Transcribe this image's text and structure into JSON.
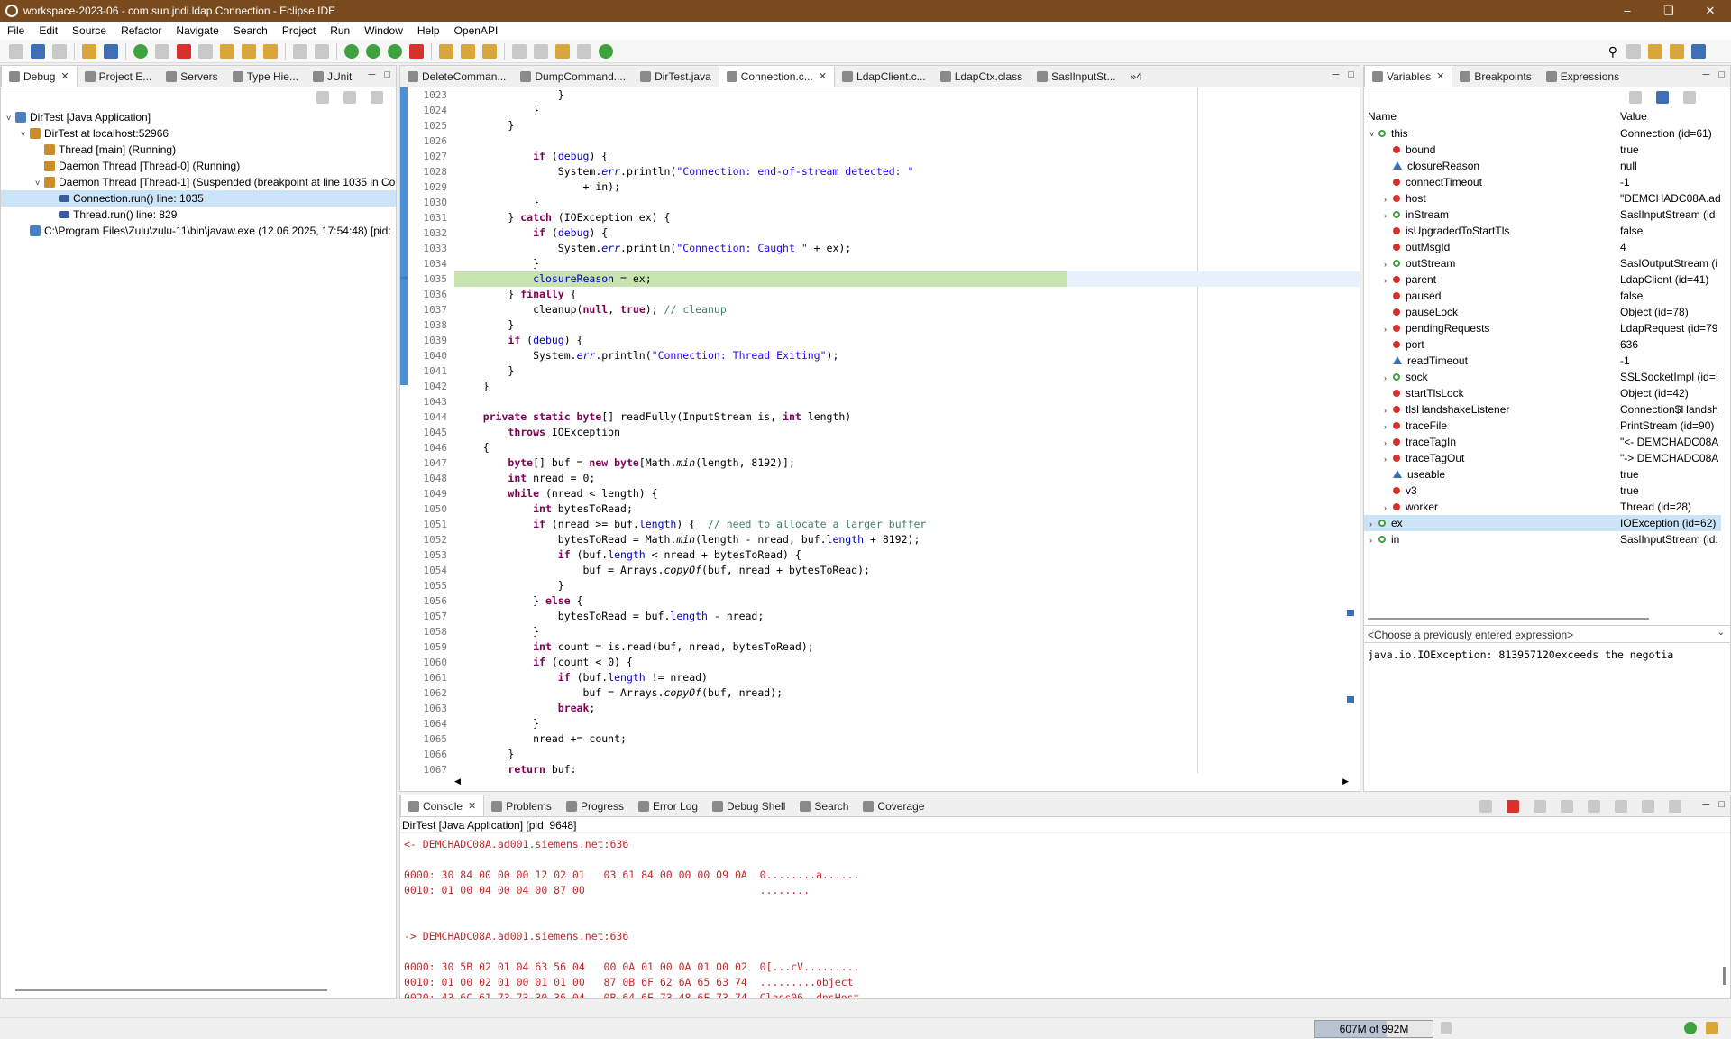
{
  "window": {
    "title": "workspace-2023-06 - com.sun.jndi.ldap.Connection - Eclipse IDE"
  },
  "menu": [
    "File",
    "Edit",
    "Source",
    "Refactor",
    "Navigate",
    "Search",
    "Project",
    "Run",
    "Window",
    "Help",
    "OpenAPI"
  ],
  "debug_panel": {
    "tabs": [
      "Debug",
      "Project E...",
      "Servers",
      "Type Hie...",
      "JUnit"
    ],
    "tree": [
      {
        "label": "DirTest [Java Application]",
        "indent": 0,
        "icon": "app",
        "arrow": "v"
      },
      {
        "label": "DirTest at localhost:52966",
        "indent": 1,
        "icon": "vm",
        "arrow": "v"
      },
      {
        "label": "Thread [main] (Running)",
        "indent": 2,
        "icon": "thread",
        "arrow": ""
      },
      {
        "label": "Daemon Thread [Thread-0] (Running)",
        "indent": 2,
        "icon": "thread",
        "arrow": ""
      },
      {
        "label": "Daemon Thread [Thread-1] (Suspended (breakpoint at line 1035 in Co",
        "indent": 2,
        "icon": "thread",
        "arrow": "v"
      },
      {
        "label": "Connection.run() line: 1035",
        "indent": 3,
        "icon": "frame",
        "arrow": "",
        "selected": true
      },
      {
        "label": "Thread.run() line: 829",
        "indent": 3,
        "icon": "frame",
        "arrow": ""
      },
      {
        "label": "C:\\Program Files\\Zulu\\zulu-11\\bin\\javaw.exe (12.06.2025, 17:54:48) [pid:",
        "indent": 1,
        "icon": "exe",
        "arrow": ""
      }
    ]
  },
  "editor": {
    "tabs": [
      "DeleteComman...",
      "DumpCommand....",
      "DirTest.java",
      "Connection.c...",
      "LdapClient.c...",
      "LdapCtx.class",
      "SaslInputSt..."
    ],
    "overflow": "»4",
    "lines": [
      {
        "n": "1023",
        "html": "                }"
      },
      {
        "n": "1024",
        "html": "            }"
      },
      {
        "n": "1025",
        "html": "        }"
      },
      {
        "n": "1026",
        "html": ""
      },
      {
        "n": "1027",
        "html": "            <span class='kw'>if</span> (<span class='fld'>debug</span>) {"
      },
      {
        "n": "1028",
        "html": "                System.<span class='fld it'>err</span>.println(<span class='str'>\"Connection: end-of-stream detected: \"</span>"
      },
      {
        "n": "1029",
        "html": "                    + in);"
      },
      {
        "n": "1030",
        "html": "            }"
      },
      {
        "n": "1031",
        "html": "        } <span class='kw'>catch</span> (IOException ex) {"
      },
      {
        "n": "1032",
        "html": "            <span class='kw'>if</span> (<span class='fld'>debug</span>) {"
      },
      {
        "n": "1033",
        "html": "                System.<span class='fld it'>err</span>.println(<span class='str'>\"Connection: Caught \"</span> + ex);"
      },
      {
        "n": "1034",
        "html": "            }"
      },
      {
        "n": "1035",
        "html": "            <span class='fld'>closureReason</span> = ex;",
        "hl": true
      },
      {
        "n": "1036",
        "html": "        } <span class='kw'>finally</span> {"
      },
      {
        "n": "1037",
        "html": "            cleanup(<span class='kw'>null</span>, <span class='kw'>true</span>); <span class='cm'>// cleanup</span>"
      },
      {
        "n": "1038",
        "html": "        }"
      },
      {
        "n": "1039",
        "html": "        <span class='kw'>if</span> (<span class='fld'>debug</span>) {"
      },
      {
        "n": "1040",
        "html": "            System.<span class='fld it'>err</span>.println(<span class='str'>\"Connection: Thread Exiting\"</span>);"
      },
      {
        "n": "1041",
        "html": "        }"
      },
      {
        "n": "1042",
        "html": "    }"
      },
      {
        "n": "1043",
        "html": ""
      },
      {
        "n": "1044",
        "html": "    <span class='kw'>private static byte</span>[] readFully(InputStream is, <span class='kw'>int</span> length)"
      },
      {
        "n": "1045",
        "html": "        <span class='kw'>throws</span> IOException"
      },
      {
        "n": "1046",
        "html": "    {"
      },
      {
        "n": "1047",
        "html": "        <span class='kw'>byte</span>[] buf = <span class='kw'>new byte</span>[Math.<span class='it'>min</span>(length, 8192)];"
      },
      {
        "n": "1048",
        "html": "        <span class='kw'>int</span> nread = 0;"
      },
      {
        "n": "1049",
        "html": "        <span class='kw'>while</span> (nread &lt; length) {"
      },
      {
        "n": "1050",
        "html": "            <span class='kw'>int</span> bytesToRead;"
      },
      {
        "n": "1051",
        "html": "            <span class='kw'>if</span> (nread &gt;= buf.<span class='fld'>length</span>) {  <span class='cm'>// need to allocate a larger buffer</span>"
      },
      {
        "n": "1052",
        "html": "                bytesToRead = Math.<span class='it'>min</span>(length - nread, buf.<span class='fld'>length</span> + 8192);"
      },
      {
        "n": "1053",
        "html": "                <span class='kw'>if</span> (buf.<span class='fld'>length</span> &lt; nread + bytesToRead) {"
      },
      {
        "n": "1054",
        "html": "                    buf = Arrays.<span class='it'>copyOf</span>(buf, nread + bytesToRead);"
      },
      {
        "n": "1055",
        "html": "                }"
      },
      {
        "n": "1056",
        "html": "            } <span class='kw'>else</span> {"
      },
      {
        "n": "1057",
        "html": "                bytesToRead = buf.<span class='fld'>length</span> - nread;"
      },
      {
        "n": "1058",
        "html": "            }"
      },
      {
        "n": "1059",
        "html": "            <span class='kw'>int</span> count = is.read(buf, nread, bytesToRead);"
      },
      {
        "n": "1060",
        "html": "            <span class='kw'>if</span> (count &lt; 0) {"
      },
      {
        "n": "1061",
        "html": "                <span class='kw'>if</span> (buf.<span class='fld'>length</span> != nread)"
      },
      {
        "n": "1062",
        "html": "                    buf = Arrays.<span class='it'>copyOf</span>(buf, nread);"
      },
      {
        "n": "1063",
        "html": "                <span class='kw'>break</span>;"
      },
      {
        "n": "1064",
        "html": "            }"
      },
      {
        "n": "1065",
        "html": "            nread += count;"
      },
      {
        "n": "1066",
        "html": "        }"
      },
      {
        "n": "1067",
        "html": "        <span class='kw'>return</span> buf;"
      }
    ]
  },
  "variables_panel": {
    "tabs": [
      "Variables",
      "Breakpoints",
      "Expressions"
    ],
    "col_name": "Name",
    "col_value": "Value",
    "rows": [
      {
        "name": "this",
        "value": "Connection  (id=61)",
        "level": 0,
        "arrow": "v",
        "dot": "g"
      },
      {
        "name": "bound",
        "value": "true",
        "level": 1,
        "arrow": "",
        "dot": "r"
      },
      {
        "name": "closureReason",
        "value": "null",
        "level": 1,
        "arrow": "",
        "dot": "t"
      },
      {
        "name": "connectTimeout",
        "value": "-1",
        "level": 1,
        "arrow": "",
        "dot": "r"
      },
      {
        "name": "host",
        "value": "\"DEMCHADC08A.ad",
        "level": 1,
        "arrow": ">",
        "dot": "r"
      },
      {
        "name": "inStream",
        "value": "SaslInputStream  (id",
        "level": 1,
        "arrow": ">",
        "dot": "g"
      },
      {
        "name": "isUpgradedToStartTls",
        "value": "false",
        "level": 1,
        "arrow": "",
        "dot": "r"
      },
      {
        "name": "outMsgId",
        "value": "4",
        "level": 1,
        "arrow": "",
        "dot": "r"
      },
      {
        "name": "outStream",
        "value": "SaslOutputStream  (i",
        "level": 1,
        "arrow": ">",
        "dot": "g"
      },
      {
        "name": "parent",
        "value": "LdapClient  (id=41)",
        "level": 1,
        "arrow": ">",
        "dot": "r"
      },
      {
        "name": "paused",
        "value": "false",
        "level": 1,
        "arrow": "",
        "dot": "r"
      },
      {
        "name": "pauseLock",
        "value": "Object  (id=78)",
        "level": 1,
        "arrow": "",
        "dot": "r"
      },
      {
        "name": "pendingRequests",
        "value": "LdapRequest  (id=79",
        "level": 1,
        "arrow": ">",
        "dot": "r"
      },
      {
        "name": "port",
        "value": "636",
        "level": 1,
        "arrow": "",
        "dot": "r"
      },
      {
        "name": "readTimeout",
        "value": "-1",
        "level": 1,
        "arrow": "",
        "dot": "t"
      },
      {
        "name": "sock",
        "value": "SSLSocketImpl  (id=!",
        "level": 1,
        "arrow": ">",
        "dot": "g"
      },
      {
        "name": "startTlsLock",
        "value": "Object  (id=42)",
        "level": 1,
        "arrow": "",
        "dot": "r"
      },
      {
        "name": "tlsHandshakeListener",
        "value": "Connection$Handsh",
        "level": 1,
        "arrow": ">",
        "dot": "r"
      },
      {
        "name": "traceFile",
        "value": "PrintStream  (id=90)",
        "level": 1,
        "arrow": ">",
        "dot": "r"
      },
      {
        "name": "traceTagIn",
        "value": "\"<- DEMCHADC08A",
        "level": 1,
        "arrow": ">",
        "dot": "r"
      },
      {
        "name": "traceTagOut",
        "value": "\"-> DEMCHADC08A",
        "level": 1,
        "arrow": ">",
        "dot": "r"
      },
      {
        "name": "useable",
        "value": "true",
        "level": 1,
        "arrow": "",
        "dot": "t"
      },
      {
        "name": "v3",
        "value": "true",
        "level": 1,
        "arrow": "",
        "dot": "r"
      },
      {
        "name": "worker",
        "value": "Thread  (id=28)",
        "level": 1,
        "arrow": ">",
        "dot": "r"
      },
      {
        "name": "ex",
        "value": "IOException  (id=62)",
        "level": 0,
        "arrow": ">",
        "dot": "g",
        "selected": true
      },
      {
        "name": "in",
        "value": "SaslInputStream  (id:",
        "level": 0,
        "arrow": ">",
        "dot": "g"
      }
    ],
    "expression_placeholder": "<Choose a previously entered expression>",
    "detail": "java.io.IOException: 813957120exceeds the negotia"
  },
  "console_panel": {
    "tabs": [
      "Console",
      "Problems",
      "Progress",
      "Error Log",
      "Debug Shell",
      "Search",
      "Coverage"
    ],
    "header": "DirTest [Java Application]  [pid: 9648]",
    "lines": [
      "<- DEMCHADC08A.ad001.siemens.net:636",
      "",
      "0000: 30 84 00 00 00 12 02 01   03 61 84 00 00 00 09 0A  0........a......",
      "0010: 01 00 04 00 04 00 87 00                            ........",
      "",
      "",
      "-> DEMCHADC08A.ad001.siemens.net:636",
      "",
      "0000: 30 5B 02 01 04 63 56 04   00 0A 01 00 0A 01 00 02  0[...cV.........",
      "0010: 01 00 02 01 00 01 01 00   87 0B 6F 62 6A 65 63 74  .........object",
      "0020: 43 6C 61 73 73 30 36 04   0B 64 6E 73 48 6F 73 74  Class06..dnsHost"
    ]
  },
  "status": {
    "memory": "607M of 992M",
    "memory_fraction": 0.61
  }
}
